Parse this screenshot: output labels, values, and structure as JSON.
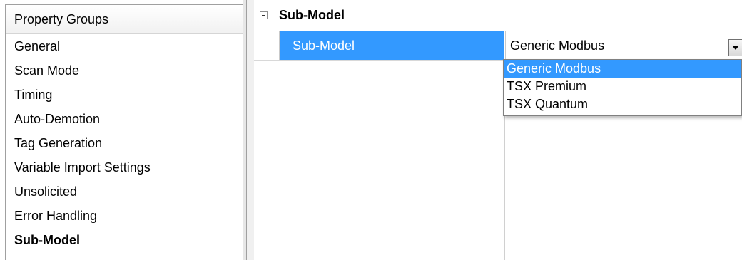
{
  "left": {
    "header": "Property Groups",
    "items": [
      {
        "label": "General"
      },
      {
        "label": "Scan Mode"
      },
      {
        "label": "Timing"
      },
      {
        "label": "Auto-Demotion"
      },
      {
        "label": "Tag Generation"
      },
      {
        "label": "Variable Import Settings"
      },
      {
        "label": "Unsolicited"
      },
      {
        "label": "Error Handling"
      },
      {
        "label": "Sub-Model"
      }
    ],
    "selected": "Sub-Model"
  },
  "right": {
    "category": "Sub-Model",
    "property": {
      "name": "Sub-Model",
      "value": "Generic Modbus"
    },
    "dropdown_options": [
      {
        "label": "Generic Modbus"
      },
      {
        "label": "TSX Premium"
      },
      {
        "label": "TSX Quantum"
      }
    ],
    "highlighted_option": "Generic Modbus"
  },
  "colors": {
    "selection": "#3399ff",
    "border": "#a0a0a0"
  },
  "icons": {
    "collapse": "minus-box-icon",
    "dropdown": "chevron-down-icon"
  }
}
